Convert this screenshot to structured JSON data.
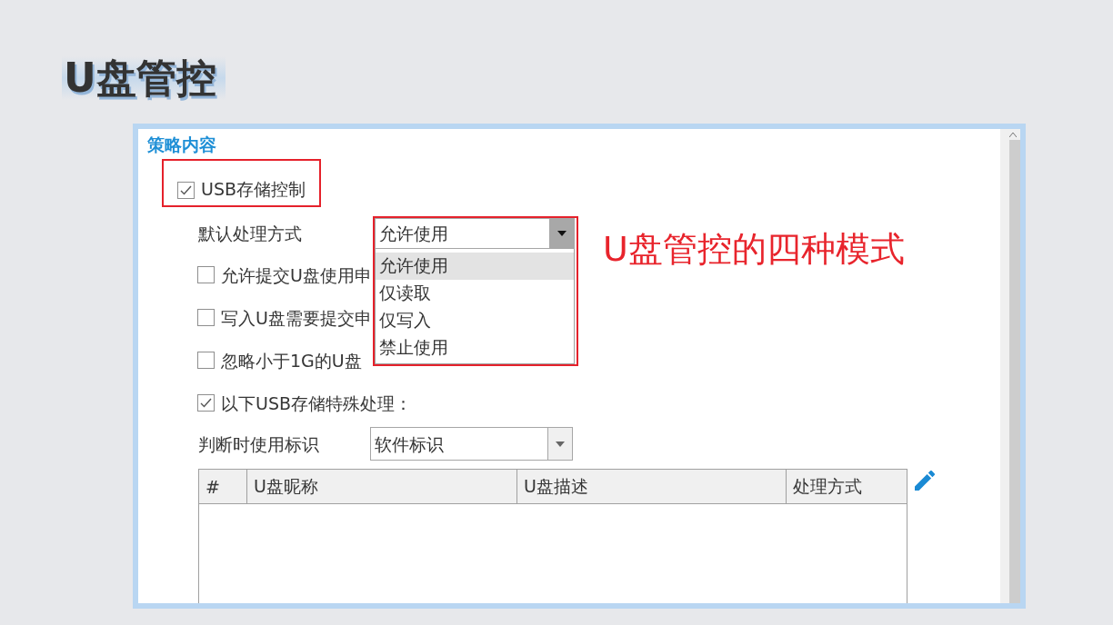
{
  "slide_title": "U盘管控",
  "panel": {
    "section_title": "策略内容",
    "usb_control": {
      "label": "USB存储控制",
      "checked": true,
      "highlighted": true
    },
    "default_mode": {
      "label": "默认处理方式",
      "value": "允许使用",
      "expanded": true,
      "highlighted": true,
      "options": [
        {
          "label": "允许使用",
          "selected": true
        },
        {
          "label": "仅读取",
          "selected": false
        },
        {
          "label": "仅写入",
          "selected": false
        },
        {
          "label": "禁止使用",
          "selected": false
        }
      ]
    },
    "annotation": "U盘管控的四种模式",
    "options": [
      {
        "label": "允许提交U盘使用申",
        "checked": false
      },
      {
        "label": "写入U盘需要提交申",
        "checked": false
      },
      {
        "label": "忽略小于1G的U盘",
        "checked": false
      },
      {
        "label": "以下USB存储特殊处理：",
        "checked": true
      }
    ],
    "identifier": {
      "label": "判断时使用标识",
      "value": "软件标识",
      "expanded": false
    },
    "table": {
      "columns": [
        "#",
        "U盘昵称",
        "U盘描述",
        "处理方式"
      ]
    }
  }
}
